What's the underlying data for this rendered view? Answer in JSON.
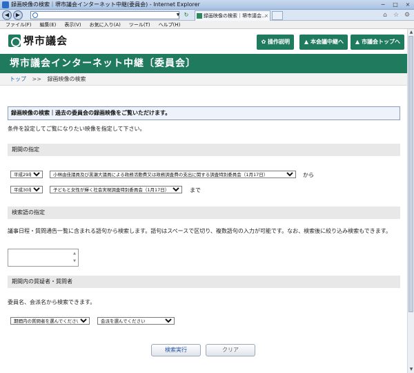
{
  "window": {
    "title": "録画映像の検索｜堺市議会インターネット中継(委員会) - Internet Explorer",
    "controls": [
      "−",
      "□",
      "×"
    ]
  },
  "browser": {
    "address_value": "",
    "tab_title": "録画映像の検索｜堺市議会...",
    "tab_close": "×"
  },
  "menu": [
    "ファイル(F)",
    "編集(E)",
    "表示(V)",
    "お気に入り(A)",
    "ツール(T)",
    "ヘルプ(H)"
  ],
  "header": {
    "logo_text": "堺市議会",
    "buttons": [
      {
        "label": "操作説明",
        "icon": "gear-icon"
      },
      {
        "label": "本会議中継へ",
        "icon": "triangle-icon"
      },
      {
        "label": "市議会トップへ",
        "icon": "triangle-icon"
      }
    ]
  },
  "banner_title": "堺市議会インターネット中継〔委員会〕",
  "breadcrumb": {
    "home": "トップ",
    "sep": ">>",
    "current": "録画映像の検索"
  },
  "notice": "録画映像の検索｜過去の委員会の録画映像をご覧いただけます。",
  "intro": "条件を設定してご覧になりたい映像を指定して下さい。",
  "period": {
    "heading": "期間の指定",
    "from_year": "平成29年",
    "from_committee": "小林由佳議員及び黒瀬大議員による政務活動費又は政務調査費の支出に関する調査特別委員会（1月17日）",
    "from_suffix": "から",
    "to_year": "平成30年",
    "to_committee": "子どもと女性が輝く社会実現調査特別委員会（1月17日）",
    "to_suffix": "まで"
  },
  "keyword": {
    "heading": "検索語の指定",
    "description": "議事日程・質問通告一覧に含まれる語句から検索します。語句はスペースで区切り、複数語句の入力が可能です。なお、検索後に絞り込み検索もできます。",
    "value": ""
  },
  "questioner": {
    "heading": "期間内の質疑者・質問者",
    "description": "委員名、会派名から検索できます。",
    "member_select": "期間内の質問者を選んでください",
    "faction_select": "会派を選んでください"
  },
  "actions": {
    "search": "検索実行",
    "clear": "クリア"
  }
}
